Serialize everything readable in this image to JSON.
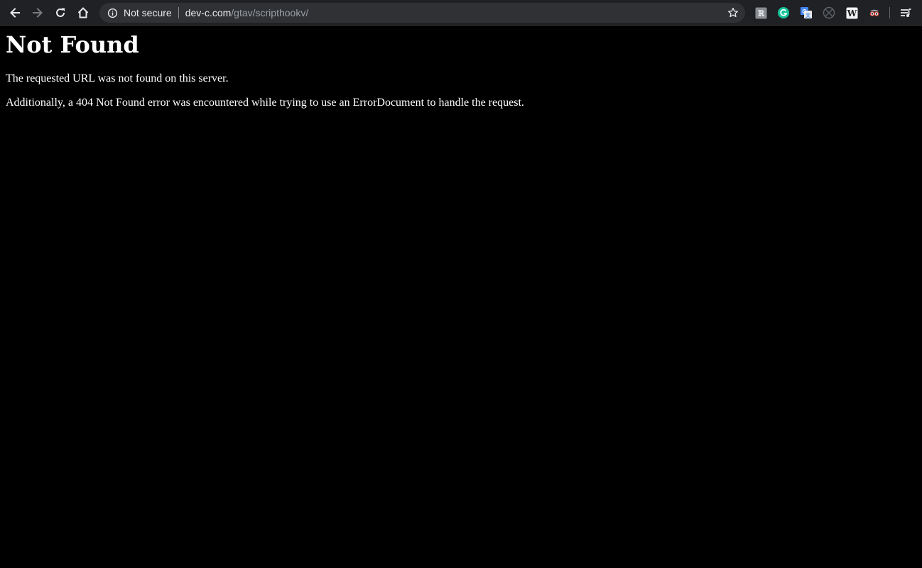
{
  "browser": {
    "security_label": "Not secure",
    "url_host": "dev-c.com",
    "url_path": "/gtav/scripthookv/",
    "extensions": [
      "extension-icon",
      "grammarly-icon",
      "google-translate-icon",
      "disabled-extension-icon",
      "wikipedia-icon",
      "spy-glasses-icon",
      "media-queue-icon"
    ],
    "colors": {
      "toolbar": "#202124",
      "omnibox": "#303134",
      "grammarly": "#15c39a",
      "translate": "#4285f4"
    }
  },
  "page": {
    "heading": "Not Found",
    "message": "The requested URL was not found on this server.",
    "additional": "Additionally, a 404 Not Found error was encountered while trying to use an ErrorDocument to handle the request.",
    "background": "#000000",
    "text_color": "#ffffff"
  }
}
